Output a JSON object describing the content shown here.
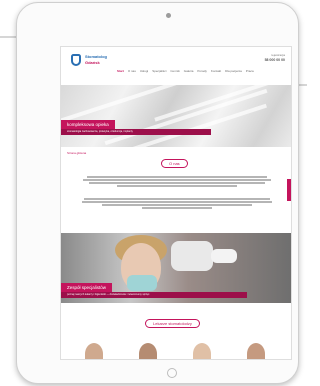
{
  "site": {
    "logo_line1": "Stomatolog",
    "logo_line2": "Gdańsk",
    "contact_label1": "rejestracja",
    "contact_phone1": "58 000 00 00",
    "contact_label2": "godziny",
    "contact_phone2": "pn–pt 8–20"
  },
  "nav": {
    "items": [
      "Start",
      "O nas",
      "Usługi",
      "Specjaliści",
      "Cennik",
      "Galeria",
      "Porady",
      "Kontakt",
      "Dla pacjenta",
      "Praca"
    ],
    "active_index": 0
  },
  "hero": {
    "label": "kompleksowa opieka",
    "strip": "stomatologia zachowawcza, protetyka, ortodoncja, implanty"
  },
  "breadcrumb": "Strona główna",
  "section1": {
    "pill": "O nas"
  },
  "team": {
    "label": "Zespół specjalistów",
    "strip": "poznaj naszych lekarzy i higienistki — doświadczenie i nowoczesny sprzęt"
  },
  "section2": {
    "pill": "Lekarze stomatolodzy"
  },
  "colors": {
    "accent": "#c4145c",
    "accent_dark": "#9c0f4a",
    "brand_blue": "#2a6fb3"
  }
}
